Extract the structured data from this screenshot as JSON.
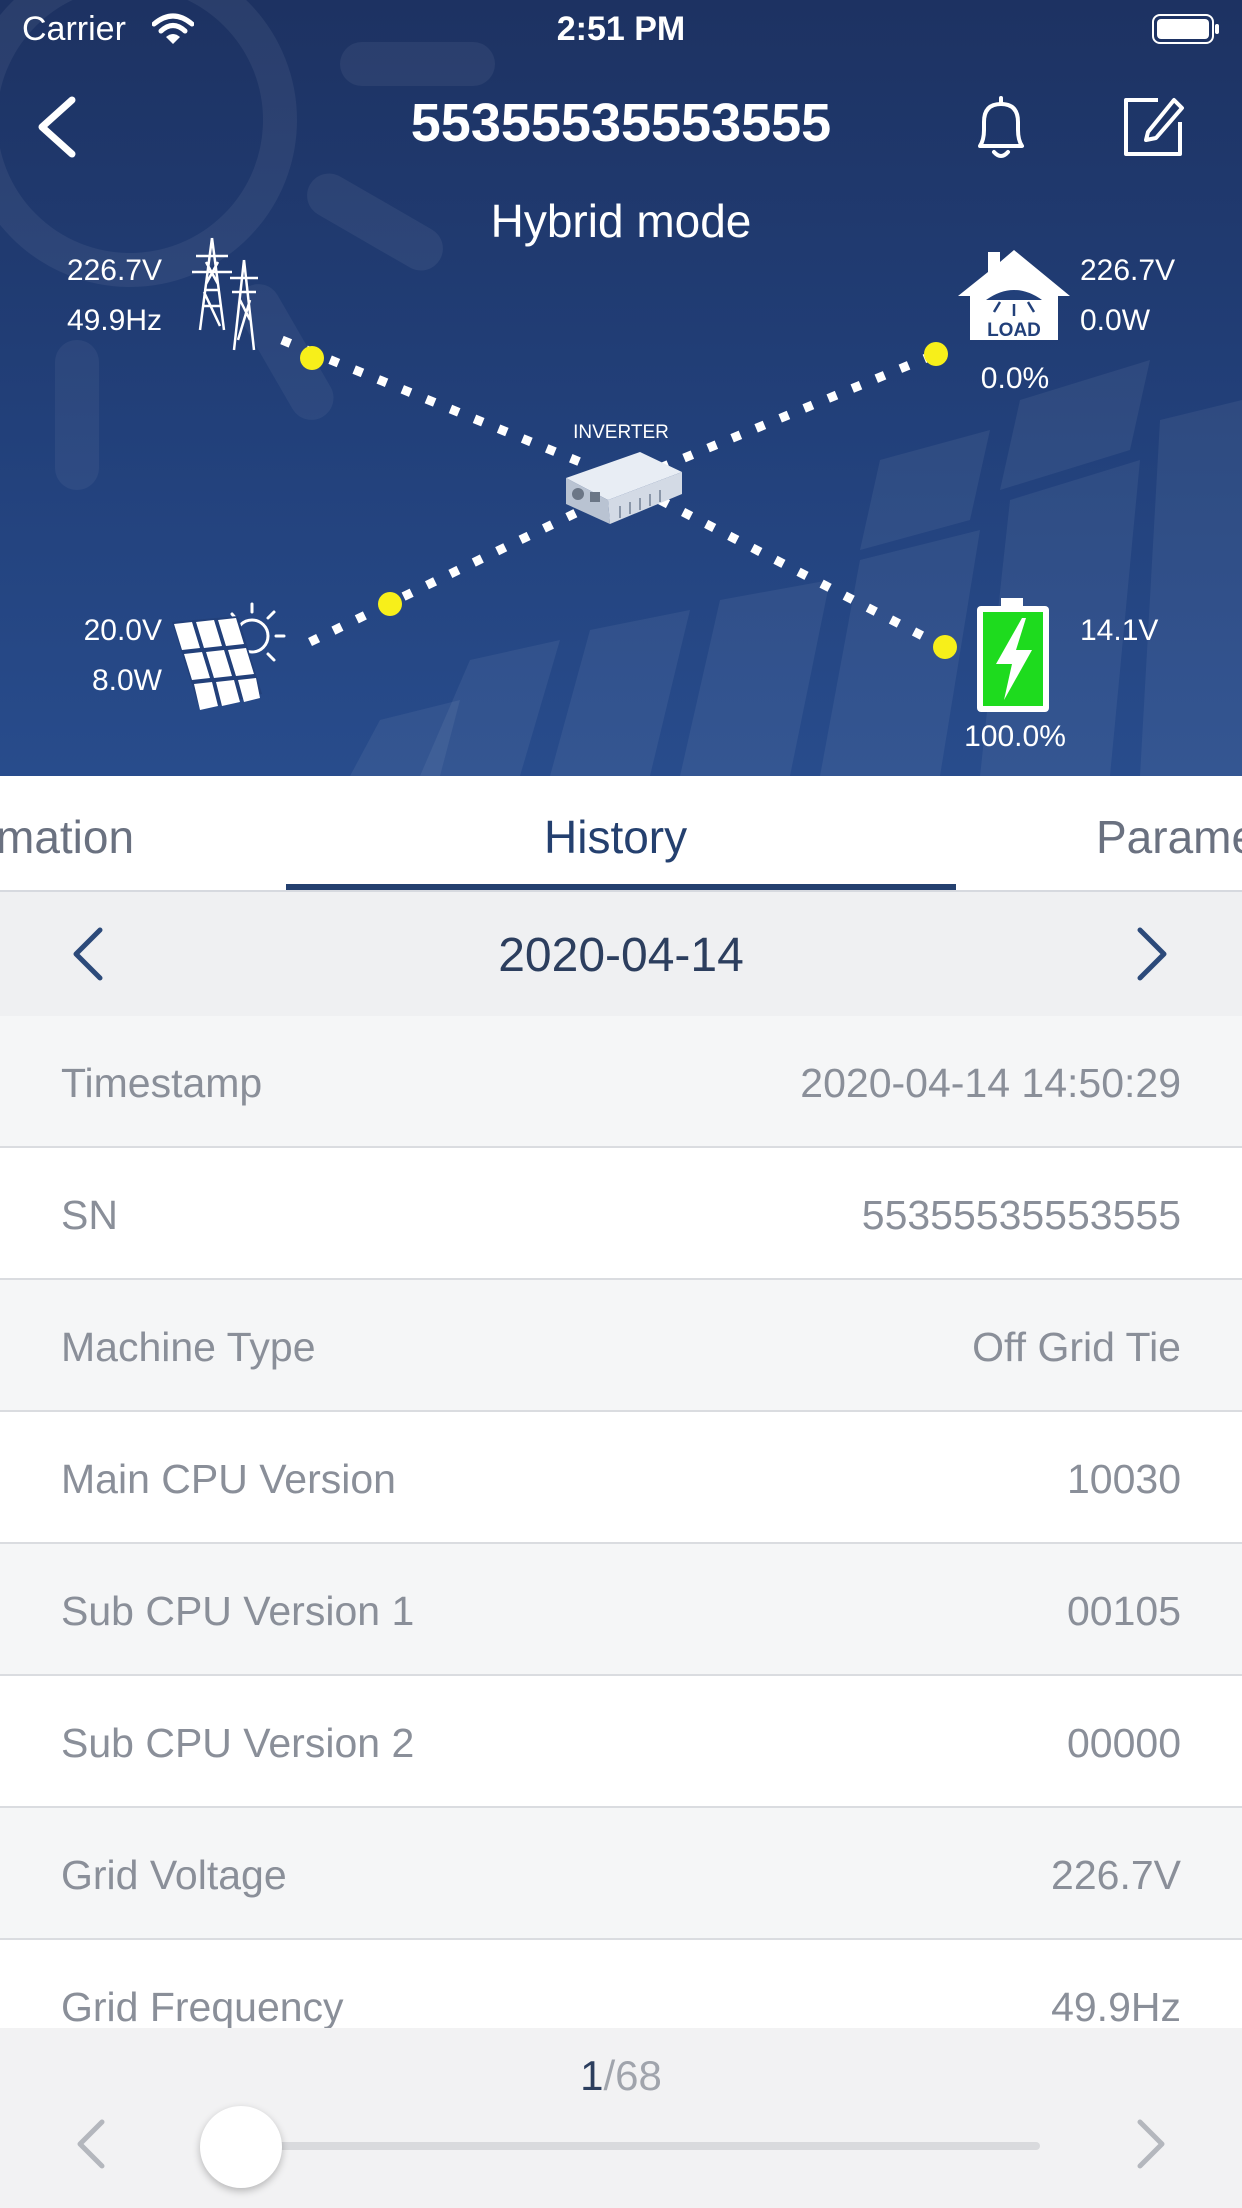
{
  "status_bar": {
    "carrier": "Carrier",
    "time": "2:51 PM"
  },
  "header": {
    "title": "55355535553555",
    "mode": "Hybrid mode"
  },
  "energy_flow": {
    "grid": {
      "voltage": "226.7V",
      "frequency": "49.9Hz"
    },
    "load": {
      "voltage": "226.7V",
      "power": "0.0W",
      "percent": "0.0%",
      "icon_text": "LOAD"
    },
    "solar": {
      "voltage": "20.0V",
      "power": "8.0W"
    },
    "battery": {
      "voltage": "14.1V",
      "percent": "100.0%"
    },
    "inverter_label": "INVERTER",
    "colors": {
      "battery": "#1edb1e",
      "flow_dot": "#f7ef1a"
    }
  },
  "tabs": [
    "mation",
    "History",
    "Parame"
  ],
  "date_nav": {
    "date": "2020-04-14"
  },
  "rows": [
    {
      "label": "Timestamp",
      "value": "2020-04-14 14:50:29"
    },
    {
      "label": "SN",
      "value": "55355535553555"
    },
    {
      "label": "Machine Type",
      "value": "Off Grid Tie"
    },
    {
      "label": "Main CPU Version",
      "value": "10030"
    },
    {
      "label": "Sub CPU Version 1",
      "value": "00105"
    },
    {
      "label": "Sub CPU Version 2",
      "value": "00000"
    },
    {
      "label": "Grid Voltage",
      "value": "226.7V"
    },
    {
      "label": "Grid Frequency",
      "value": "49.9Hz"
    }
  ],
  "pager": {
    "current": "1",
    "total": "/68",
    "slider_fraction": 0.0
  },
  "colors": {
    "header_bg": "#22407a",
    "accent": "#24406f"
  }
}
